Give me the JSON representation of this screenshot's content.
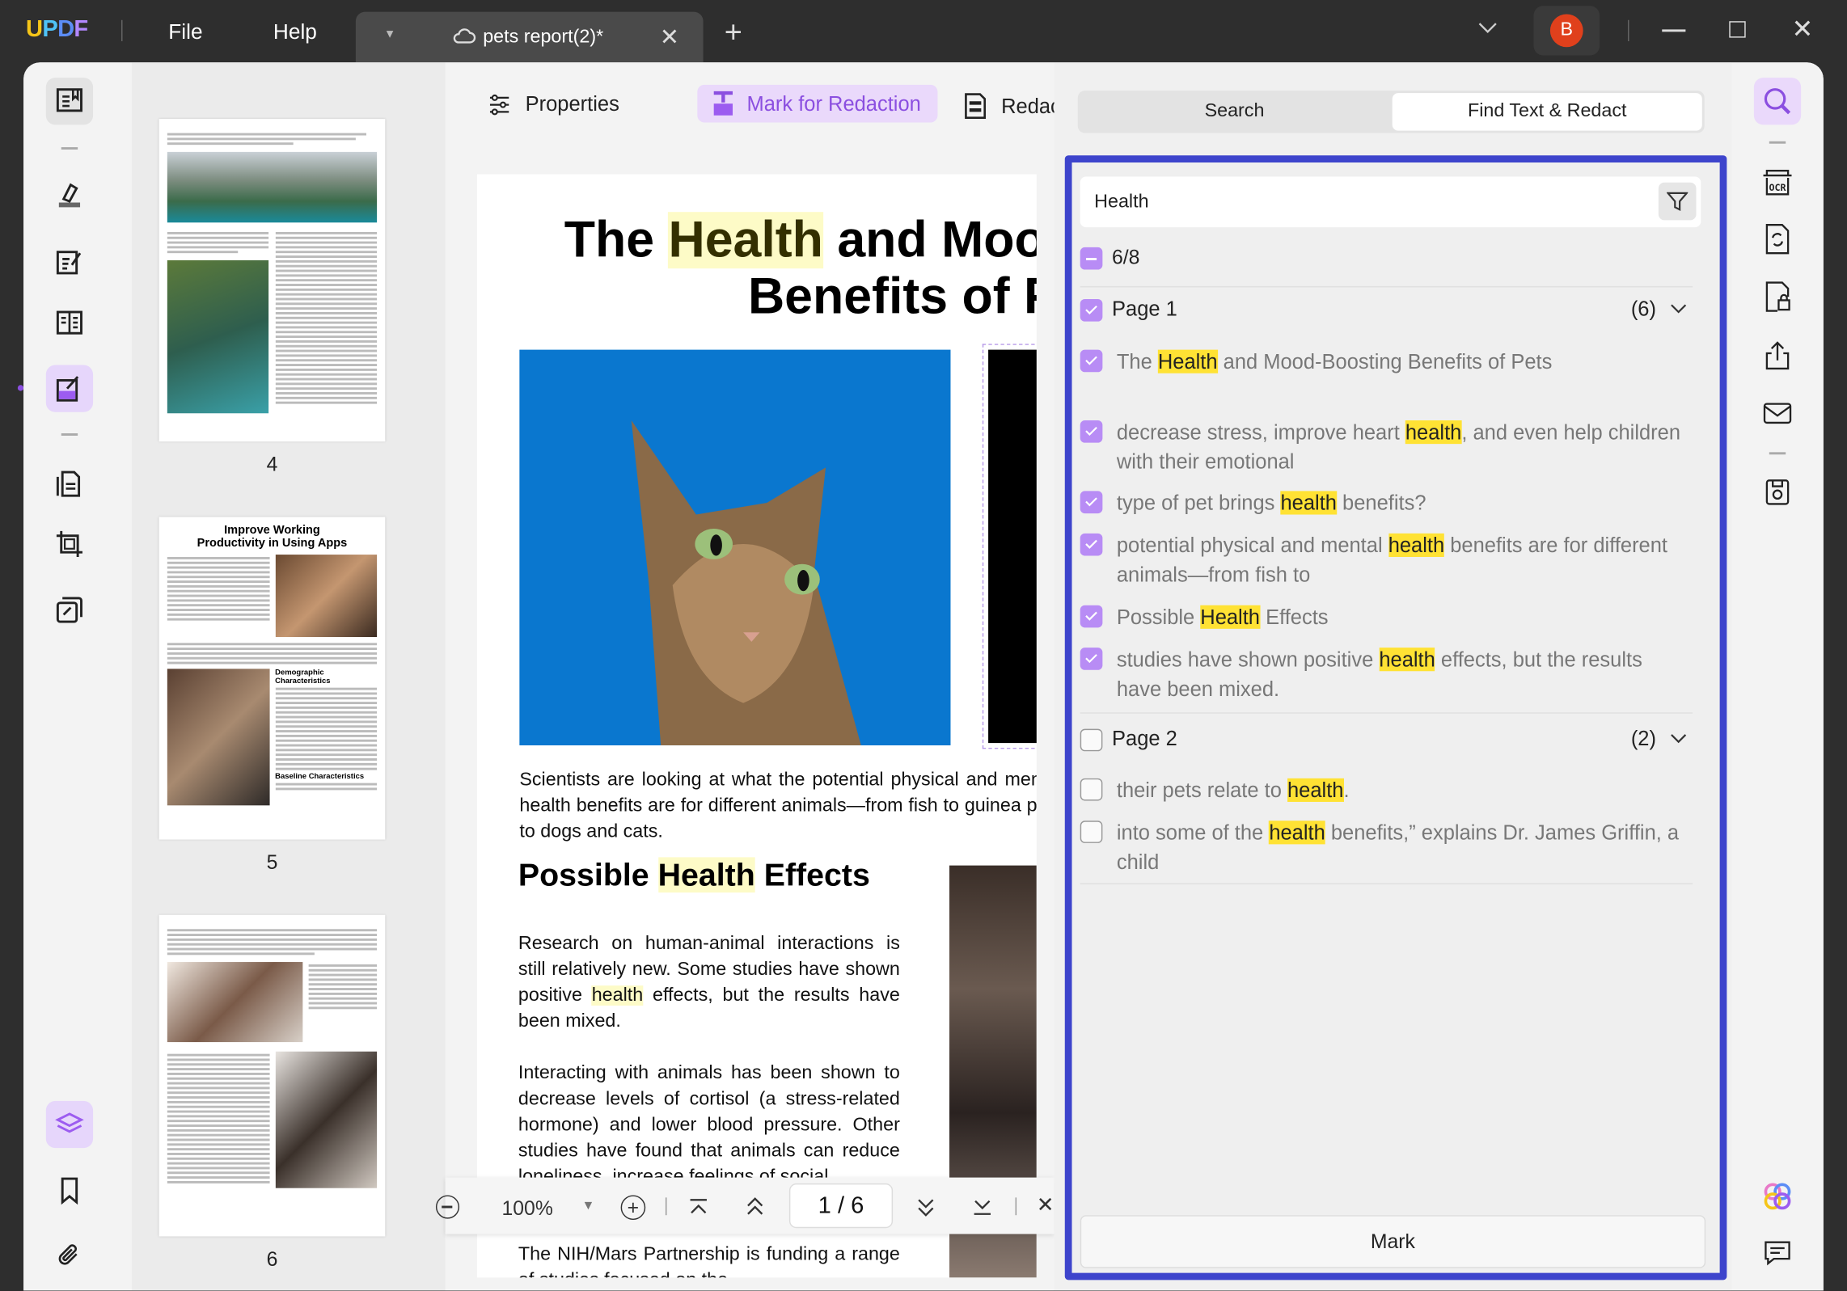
{
  "app": {
    "logo": "UPDF",
    "menu": [
      "File",
      "Help"
    ],
    "tab_title": "pets report(2)*",
    "avatar_initial": "B",
    "accent": "#8b4fe0",
    "avatar_color": "#e0401c"
  },
  "toolbar": {
    "properties": "Properties",
    "mark_for_redaction": "Mark for Redaction",
    "redact": "Redact"
  },
  "thumbnails": {
    "pages": [
      {
        "label": "4"
      },
      {
        "label": "5",
        "heading": "Improve Working Productivity in Using Apps",
        "sub1": "Demographic Characteristics",
        "sub2": "Baseline Characteristics"
      },
      {
        "label": "6"
      }
    ]
  },
  "document": {
    "title_pre": "The ",
    "title_hit": "Health",
    "title_post": " and Mood-Boosting",
    "title_line2": "Benefits of Pets",
    "caption": "Scientists are looking at what the potential physical and mental health benefits are for different animals—from fish to guinea pigs to dogs and cats.",
    "section_pre": "Possible ",
    "section_hit": "Health",
    "section_post": " Effects",
    "para1_pre": "Research on human-animal interactions is still relatively new. Some studies have shown positive ",
    "para1_hit": "health",
    "para1_post": " effects, but the results have been mixed.",
    "para2": "Interacting with animals has been shown to decrease levels of cortisol (a stress-related hormone) and lower blood pressure. Other studies have found that animals can reduce loneliness, increase feelings of social",
    "para3": "The NIH/Mars Partnership is funding a range of studies focused on the"
  },
  "nav": {
    "zoom": "100%",
    "page": "1 / 6"
  },
  "panel": {
    "tabs": [
      "Search",
      "Find Text & Redact"
    ],
    "active_tab": 1,
    "query": "Health",
    "summary": "6/8",
    "groups": [
      {
        "label": "Page 1",
        "count": "(6)",
        "checked": true,
        "items": [
          {
            "pre": "The ",
            "hit": "Health",
            "post": " and Mood-Boosting Benefits of Pets",
            "checked": true
          },
          {
            "pre": "decrease stress, improve heart ",
            "hit": "health",
            "post": ", and even help children with their emotional",
            "checked": true
          },
          {
            "pre": "type of pet brings ",
            "hit": "health",
            "post": " benefits?",
            "checked": true
          },
          {
            "pre": "potential physical and mental ",
            "hit": "health",
            "post": " benefits are for different animals—from fish to",
            "checked": true
          },
          {
            "pre": "Possible ",
            "hit": "Health",
            "post": " Effects",
            "checked": true
          },
          {
            "pre": "studies have shown positive ",
            "hit": "health",
            "post": " effects, but the results have been mixed.",
            "checked": true
          }
        ]
      },
      {
        "label": "Page 2",
        "count": "(2)",
        "checked": false,
        "items": [
          {
            "pre": "their pets relate to ",
            "hit": "health",
            "post": ".",
            "checked": false
          },
          {
            "pre": "into some of the ",
            "hit": "health",
            "post": " benefits,” explains Dr. James Griffin, a child",
            "checked": false
          }
        ]
      }
    ],
    "mark_button": "Mark"
  }
}
